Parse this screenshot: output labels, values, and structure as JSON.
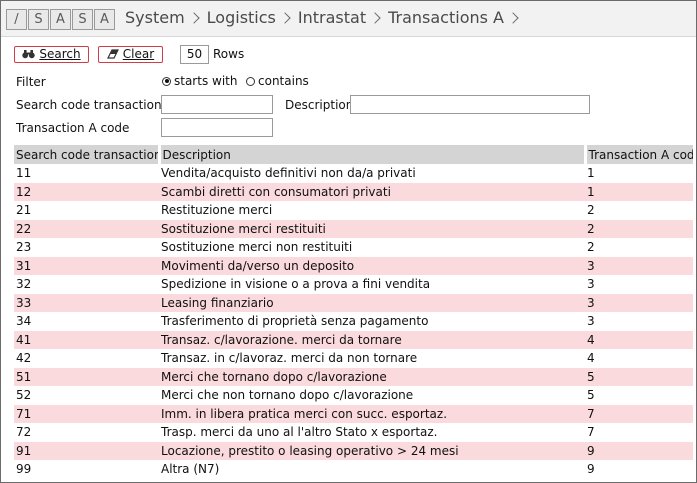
{
  "logo": {
    "letters": [
      "/",
      "S",
      "A",
      "S",
      "A"
    ]
  },
  "breadcrumb": [
    "System",
    "Logistics",
    "Intrastat",
    "Transactions A"
  ],
  "toolbar": {
    "search_label": "Search",
    "clear_label": "Clear",
    "rows_value": "50",
    "rows_label": "Rows"
  },
  "filter": {
    "label": "Filter",
    "option_starts": "starts with",
    "option_contains": "contains",
    "selected": "starts with",
    "search_code_label": "Search code transaction A",
    "search_code_value": "",
    "description_label": "Description",
    "description_value": "",
    "code_label": "Transaction A code",
    "code_value": ""
  },
  "table": {
    "columns": [
      "Search code transaction A",
      "Description",
      "Transaction A code"
    ],
    "rows": [
      [
        "11",
        "Vendita/acquisto definitivi non da/a privati",
        "1"
      ],
      [
        "12",
        "Scambi diretti con consumatori privati",
        "1"
      ],
      [
        "21",
        "Restituzione merci",
        "2"
      ],
      [
        "22",
        "Sostituzione merci restituiti",
        "2"
      ],
      [
        "23",
        "Sostituzione merci non restituiti",
        "2"
      ],
      [
        "31",
        "Movimenti da/verso un deposito",
        "3"
      ],
      [
        "32",
        "Spedizione in visione o a prova a fini vendita",
        "3"
      ],
      [
        "33",
        "Leasing finanziario",
        "3"
      ],
      [
        "34",
        "Trasferimento di proprietà senza pagamento",
        "3"
      ],
      [
        "41",
        "Transaz. c/lavorazione. merci da tornare",
        "4"
      ],
      [
        "42",
        "Transaz. in c/lavoraz. merci da non tornare",
        "4"
      ],
      [
        "51",
        "Merci che tornano dopo c/lavorazione",
        "5"
      ],
      [
        "52",
        "Merci che non tornano dopo c/lavorazione",
        "5"
      ],
      [
        "71",
        "Imm. in libera pratica merci con succ. esportaz.",
        "7"
      ],
      [
        "72",
        "Trasp. merci da uno al l'altro Stato x esportaz.",
        "7"
      ],
      [
        "91",
        "Locazione, prestito o leasing operativo > 24 mesi",
        "9"
      ],
      [
        "99",
        "Altra (N7)",
        "9"
      ]
    ]
  },
  "colors": {
    "accent": "#d23c4a",
    "row_alt": "#fadadd",
    "header_bg": "#d4d4d4"
  }
}
